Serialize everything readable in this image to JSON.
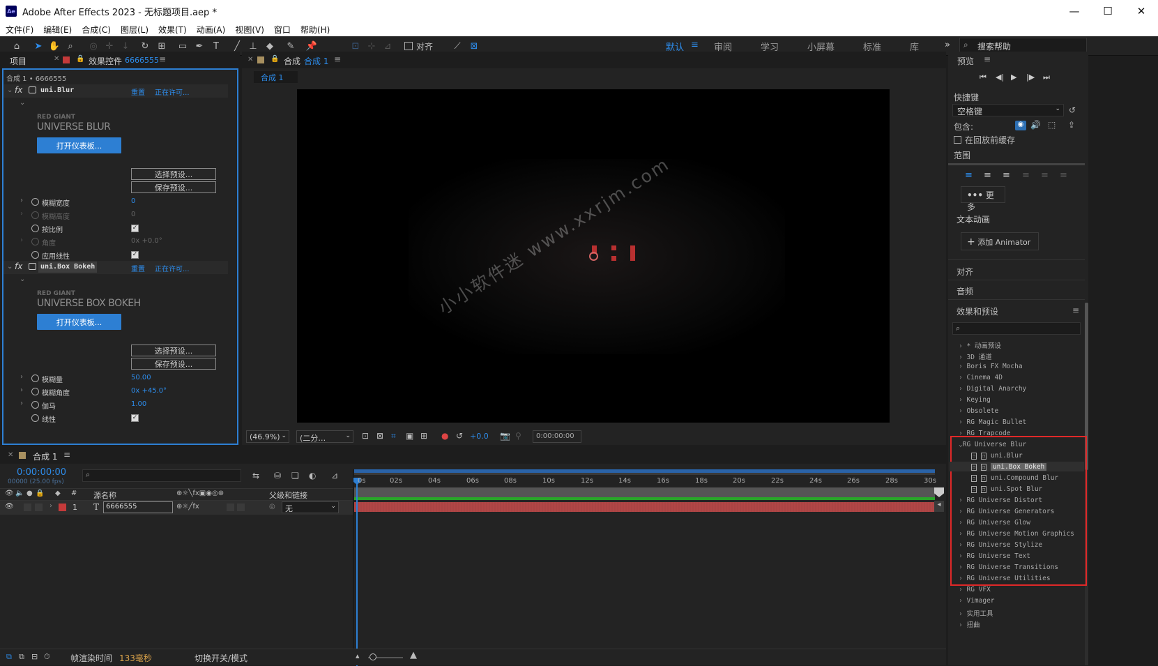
{
  "window": {
    "title": "Adobe After Effects 2023 - 无标题项目.aep *",
    "minimize": "—",
    "maximize": "☐",
    "close": "✕"
  },
  "menu": [
    "文件(F)",
    "编辑(E)",
    "合成(C)",
    "图层(L)",
    "效果(T)",
    "动画(A)",
    "视图(V)",
    "窗口",
    "帮助(H)"
  ],
  "toolbar": {
    "align_label": "对齐",
    "workspaces": [
      "默认",
      "审阅",
      "学习",
      "小屏幕",
      "标准",
      "库"
    ],
    "more": "»",
    "search_placeholder": "搜索帮助"
  },
  "left_panel": {
    "tab_project": "项目",
    "tab_effects": "效果控件",
    "tab_effects_layer": "6666555",
    "breadcrumb": "合成 1 • 6666555",
    "effect1": {
      "name": "uni.Blur",
      "reset": "重置",
      "license": "正在许可...",
      "brand_small": "RED GIANT",
      "brand_big": "UNIVERSE BLUR",
      "dashboard": "打开仪表板...",
      "select_preset": "选择预设...",
      "save_preset": "保存预设...",
      "params": [
        {
          "label": "模糊宽度",
          "value": "0",
          "dim": false
        },
        {
          "label": "模糊高度",
          "value": "0",
          "dim": true
        },
        {
          "label": "按比例",
          "value": "✓",
          "dim": false
        },
        {
          "label": "角度",
          "value": "0x +0.0°",
          "dim": true
        },
        {
          "label": "应用线性",
          "value": "✓",
          "dim": false
        }
      ]
    },
    "effect2": {
      "name": "uni.Box Bokeh",
      "reset": "重置",
      "license": "正在许可...",
      "brand_small": "RED GIANT",
      "brand_big": "UNIVERSE BOX BOKEH",
      "dashboard": "打开仪表板...",
      "select_preset": "选择预设...",
      "save_preset": "保存预设...",
      "params": [
        {
          "label": "模糊量",
          "value": "50.00"
        },
        {
          "label": "模糊角度",
          "value": "0x +45.0°"
        },
        {
          "label": "伽马",
          "value": "1.00"
        },
        {
          "label": "线性",
          "value": "✓"
        }
      ]
    }
  },
  "comp_panel": {
    "tab": "合成",
    "tab_name": "合成 1",
    "comp_tab": "合成 1",
    "watermark": "小小软件迷 www.xxrjm.com",
    "zoom": "(46.9%)",
    "resolution": "(二分…",
    "exposure": "+0.0",
    "timecode": "0:00:00:00"
  },
  "right_panel": {
    "preview_title": "预览",
    "shortcut_label": "快捷键",
    "shortcut_value": "空格键",
    "include_label": "包含:",
    "cache_label": "在回放前缓存",
    "range_label": "范围",
    "more": "更多",
    "text_anim": "文本动画",
    "add_animator": "添加 Animator",
    "align": "对齐",
    "audio": "音频",
    "effects_presets": "效果和预设",
    "categories": [
      "* 动画预设",
      "3D 通道",
      "Boris FX Mocha",
      "Cinema 4D",
      "Digital Anarchy",
      "Keying",
      "Obsolete",
      "RG Magic Bullet",
      "RG Trapcode",
      "RG Universe Blur"
    ],
    "subitems": [
      "uni.Blur",
      "uni.Box Bokeh",
      "uni.Compound Blur",
      "uni.Spot Blur"
    ],
    "categories2": [
      "RG Universe Distort",
      "RG Universe Generators",
      "RG Universe Glow",
      "RG Universe Motion Graphics",
      "RG Universe Stylize",
      "RG Universe Text",
      "RG Universe Transitions",
      "RG Universe Utilities",
      "RG VFX",
      "Vimager",
      "实用工具",
      "扭曲"
    ]
  },
  "timeline": {
    "tab": "合成 1",
    "timecode": "0:00:00:00",
    "fps": "00000 (25.00 fps)",
    "col_num": "#",
    "col_source": "源名称",
    "col_parent": "父级和链接",
    "layer": {
      "num": "1",
      "type": "T",
      "name": "6666555",
      "parent": "无"
    },
    "ticks": [
      "0s",
      "02s",
      "04s",
      "06s",
      "08s",
      "10s",
      "12s",
      "14s",
      "16s",
      "18s",
      "20s",
      "22s",
      "24s",
      "26s",
      "28s",
      "30s"
    ],
    "render_label": "帧渲染时间",
    "render_value": "133毫秒",
    "toggle_label": "切换开关/模式"
  }
}
